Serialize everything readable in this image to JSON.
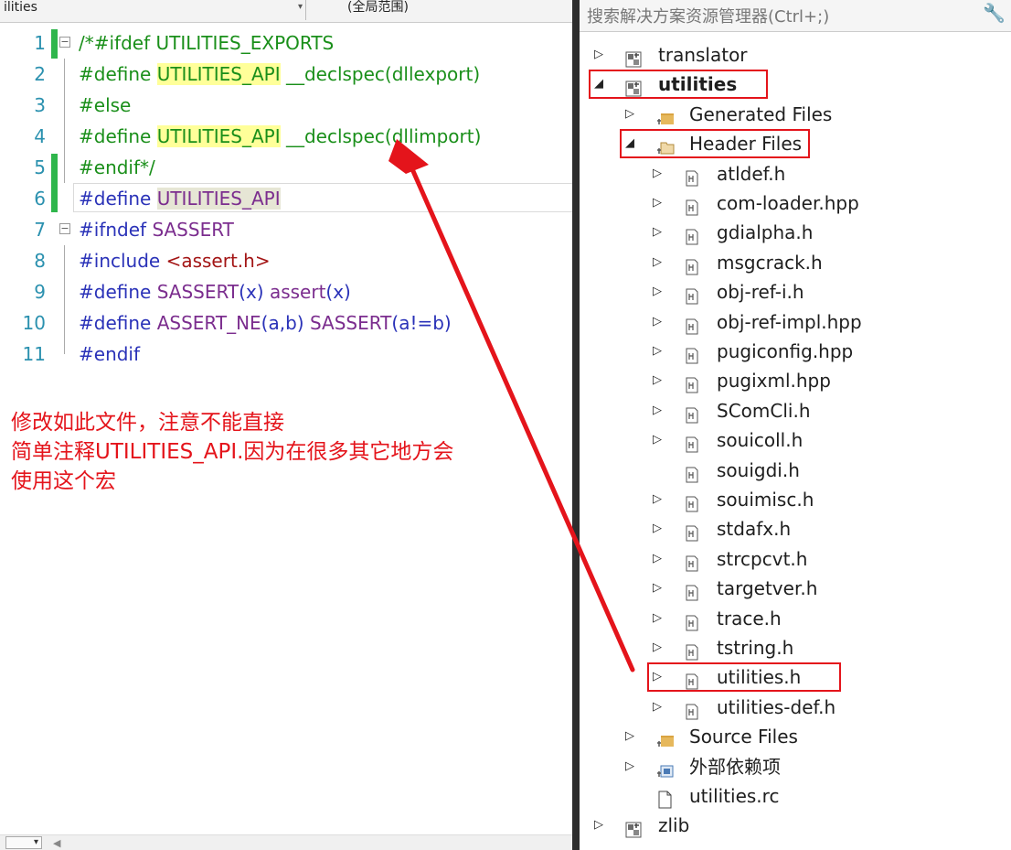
{
  "editor": {
    "scope_combo": "ilities",
    "member_combo": "(全局范围)",
    "lines": [
      {
        "num": "1",
        "segments": [
          {
            "t": "/*#ifdef UTILITIES_EXPORTS",
            "c": "cm"
          }
        ]
      },
      {
        "num": "2",
        "segments": [
          {
            "t": "#define ",
            "c": "cm"
          },
          {
            "t": "UTILITIES_API",
            "c": "cm hl"
          },
          {
            "t": " __declspec(dllexport)",
            "c": "cm"
          }
        ]
      },
      {
        "num": "3",
        "segments": [
          {
            "t": "#else",
            "c": "cm"
          }
        ]
      },
      {
        "num": "4",
        "segments": [
          {
            "t": "#define ",
            "c": "cm"
          },
          {
            "t": "UTILITIES_API",
            "c": "cm hl"
          },
          {
            "t": " __declspec(dllimport)",
            "c": "cm"
          }
        ]
      },
      {
        "num": "5",
        "segments": [
          {
            "t": "#endif*/",
            "c": "cm"
          }
        ]
      },
      {
        "num": "6",
        "segments": [
          {
            "t": "#define ",
            "c": "kw"
          },
          {
            "t": "UTILITIES_API",
            "c": "mac hl2"
          }
        ]
      },
      {
        "num": "7",
        "segments": [
          {
            "t": "#ifndef ",
            "c": "kw"
          },
          {
            "t": "SASSERT",
            "c": "mac"
          }
        ]
      },
      {
        "num": "8",
        "segments": [
          {
            "t": "#include ",
            "c": "kw"
          },
          {
            "t": "<assert.h>",
            "c": "str"
          }
        ]
      },
      {
        "num": "9",
        "segments": [
          {
            "t": "#define ",
            "c": "kw"
          },
          {
            "t": "SASSERT",
            "c": "mac"
          },
          {
            "t": "(x) ",
            "c": "kw"
          },
          {
            "t": "assert",
            "c": "mac"
          },
          {
            "t": "(x)",
            "c": "kw"
          }
        ]
      },
      {
        "num": "10",
        "segments": [
          {
            "t": "#define ",
            "c": "kw"
          },
          {
            "t": "ASSERT_NE",
            "c": "mac"
          },
          {
            "t": "(a,b) ",
            "c": "kw"
          },
          {
            "t": "SASSERT",
            "c": "mac"
          },
          {
            "t": "(a!=b)",
            "c": "kw"
          }
        ]
      },
      {
        "num": "11",
        "segments": [
          {
            "t": "#endif",
            "c": "kw"
          }
        ]
      }
    ],
    "annotation": [
      "修改如此文件，注意不能直接",
      "简单注释UTILITIES_API.因为在很多其它地方会",
      "使用这个宏"
    ]
  },
  "explorer": {
    "search_placeholder": "搜索解决方案资源管理器(Ctrl+;)",
    "tree": [
      {
        "label": "translator",
        "level": 0,
        "tri": "▷",
        "icon": "project-icon",
        "bold": false
      },
      {
        "label": "utilities",
        "level": 0,
        "tri": "◢",
        "icon": "project-icon",
        "bold": true,
        "boxed": true
      },
      {
        "label": "Generated Files",
        "level": 1,
        "tri": "▷",
        "icon": "folder-icon",
        "bold": false
      },
      {
        "label": "Header Files",
        "level": 1,
        "tri": "◢",
        "icon": "folder-open-icon",
        "bold": false,
        "boxed": true
      },
      {
        "label": "atldef.h",
        "level": 2,
        "tri": "▷",
        "icon": "header-file-icon"
      },
      {
        "label": "com-loader.hpp",
        "level": 2,
        "tri": "▷",
        "icon": "header-file-icon"
      },
      {
        "label": "gdialpha.h",
        "level": 2,
        "tri": "▷",
        "icon": "header-file-icon"
      },
      {
        "label": "msgcrack.h",
        "level": 2,
        "tri": "▷",
        "icon": "header-file-icon"
      },
      {
        "label": "obj-ref-i.h",
        "level": 2,
        "tri": "▷",
        "icon": "header-file-icon"
      },
      {
        "label": "obj-ref-impl.hpp",
        "level": 2,
        "tri": "▷",
        "icon": "header-file-icon"
      },
      {
        "label": "pugiconfig.hpp",
        "level": 2,
        "tri": "▷",
        "icon": "header-file-icon"
      },
      {
        "label": "pugixml.hpp",
        "level": 2,
        "tri": "▷",
        "icon": "header-file-icon"
      },
      {
        "label": "SComCli.h",
        "level": 2,
        "tri": "▷",
        "icon": "header-file-icon"
      },
      {
        "label": "souicoll.h",
        "level": 2,
        "tri": "▷",
        "icon": "header-file-icon"
      },
      {
        "label": "souigdi.h",
        "level": 2,
        "tri": "",
        "icon": "header-file-icon"
      },
      {
        "label": "souimisc.h",
        "level": 2,
        "tri": "▷",
        "icon": "header-file-icon"
      },
      {
        "label": "stdafx.h",
        "level": 2,
        "tri": "▷",
        "icon": "header-file-icon"
      },
      {
        "label": "strcpcvt.h",
        "level": 2,
        "tri": "▷",
        "icon": "header-file-icon"
      },
      {
        "label": "targetver.h",
        "level": 2,
        "tri": "▷",
        "icon": "header-file-icon"
      },
      {
        "label": "trace.h",
        "level": 2,
        "tri": "▷",
        "icon": "header-file-icon"
      },
      {
        "label": "tstring.h",
        "level": 2,
        "tri": "▷",
        "icon": "header-file-icon"
      },
      {
        "label": "utilities.h",
        "level": 2,
        "tri": "▷",
        "icon": "header-file-icon",
        "boxed": true
      },
      {
        "label": "utilities-def.h",
        "level": 2,
        "tri": "▷",
        "icon": "header-file-icon"
      },
      {
        "label": "Source Files",
        "level": 1,
        "tri": "▷",
        "icon": "folder-icon"
      },
      {
        "label": "外部依赖项",
        "level": 1,
        "tri": "▷",
        "icon": "external-deps-icon"
      },
      {
        "label": "utilities.rc",
        "level": 1,
        "tri": "",
        "icon": "resource-file-icon"
      },
      {
        "label": "zlib",
        "level": 0,
        "tri": "▷",
        "icon": "project-icon"
      }
    ]
  },
  "colors": {
    "annotation_red": "#e4141b",
    "comment_green": "#1a8f1a",
    "keyword_blue": "#2a32b8",
    "highlight_yellow": "#ffff99"
  }
}
